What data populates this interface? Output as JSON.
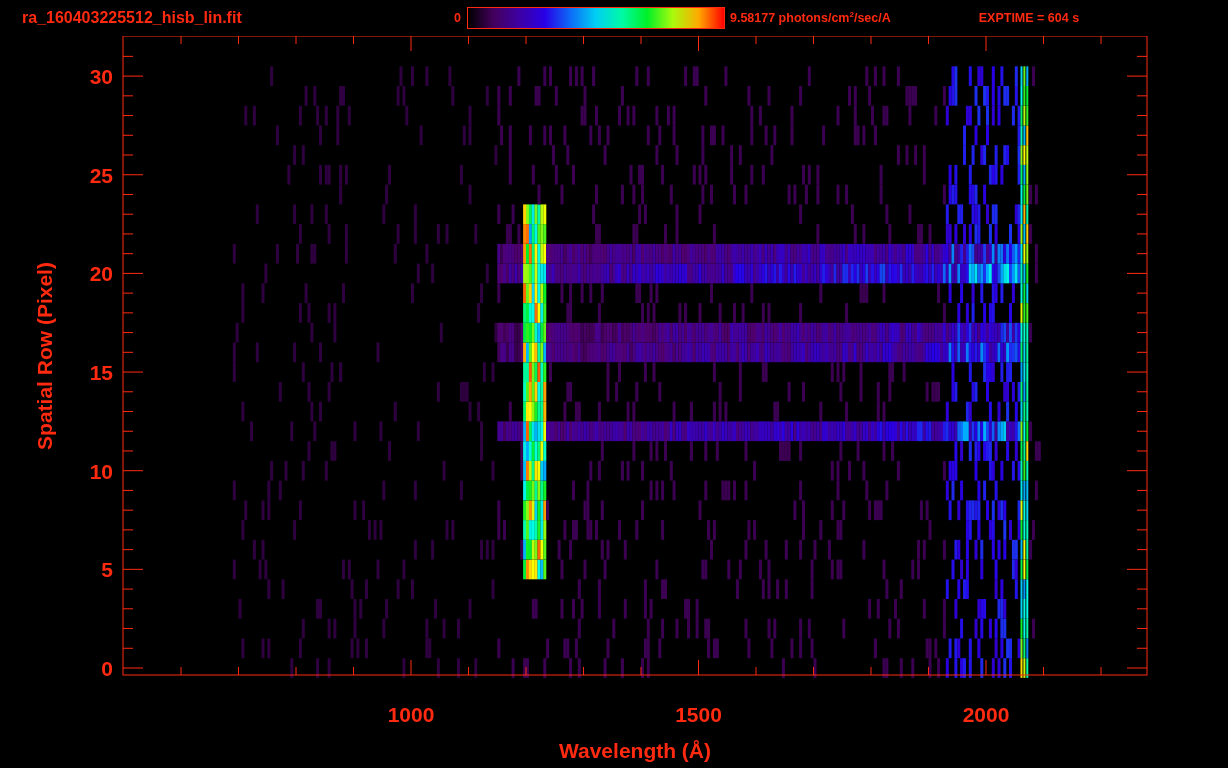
{
  "title": "ra_160403225512_hisb_lin.fit",
  "colorbar": {
    "min_label": "0",
    "max_label": "9.58177 photons/cm$^{2}$/sec/A"
  },
  "exposure": "EXPTIME = 604 s",
  "plot": {
    "xlabel": "Wavelength (Å)",
    "ylabel": "Spatial Row (Pixel)",
    "xticks": [
      "1000",
      "1500",
      "2000"
    ],
    "yticks": [
      "30",
      "25",
      "20",
      "15",
      "10",
      "5",
      "0"
    ]
  }
}
